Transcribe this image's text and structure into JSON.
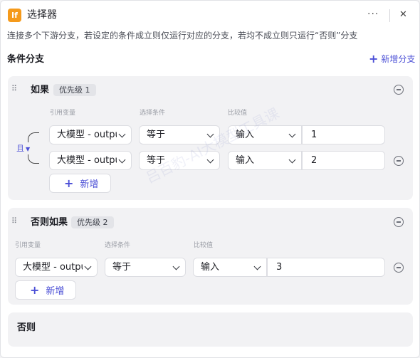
{
  "header": {
    "icon_text": "If",
    "title": "选择器",
    "more_label": "···",
    "close_label": "✕"
  },
  "description": "连接多个下游分支，若设定的条件成立则仅运行对应的分支，若均不成立则只运行“否则”分支",
  "section": {
    "title": "条件分支",
    "add_branch_label": "新增分支"
  },
  "columns": {
    "ref_var": "引用变量",
    "condition": "选择条件",
    "compare": "比较值"
  },
  "branches": [
    {
      "label": "如果",
      "priority": "优先级 1",
      "logic": "且",
      "conditions": [
        {
          "variable": "大模型 - output",
          "operator": "等于",
          "value_type": "输入",
          "value": "1"
        },
        {
          "variable": "大模型 - output",
          "operator": "等于",
          "value_type": "输入",
          "value": "2"
        }
      ],
      "add_label": "新增"
    },
    {
      "label": "否则如果",
      "priority": "优先级 2",
      "conditions": [
        {
          "variable": "大模型 - output",
          "operator": "等于",
          "value_type": "输入",
          "value": "3"
        }
      ],
      "add_label": "新增"
    }
  ],
  "else_branch": {
    "label": "否则"
  },
  "watermark": "吕百豹-AI大模型工具课",
  "colors": {
    "accent": "#4b4fd6",
    "icon_bg": "#f59a1b",
    "card_bg": "#f2f2f4"
  }
}
